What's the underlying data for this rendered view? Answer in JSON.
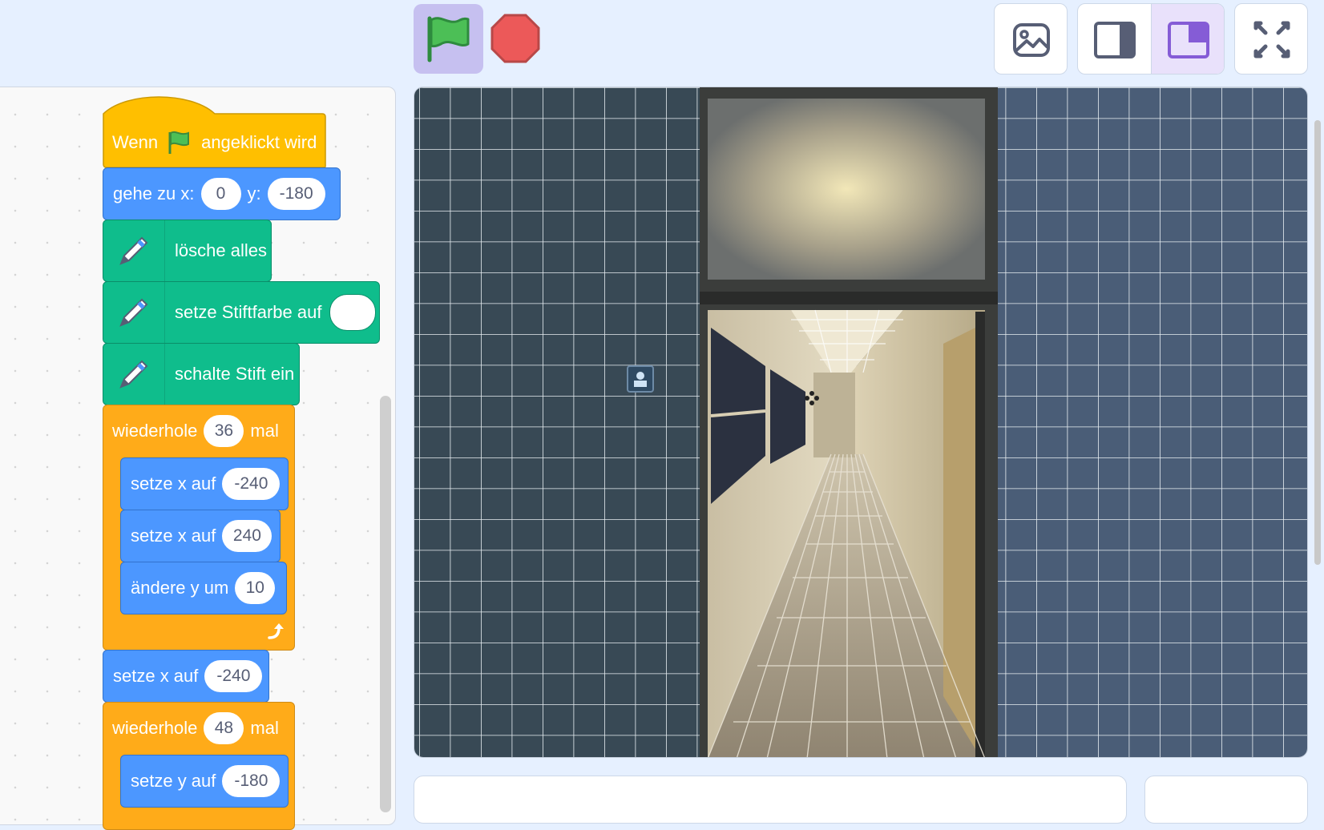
{
  "toolbar": {
    "green_flag": "green-flag-icon",
    "stop": "stop-icon",
    "buttons": [
      "image-icon",
      "small-stage-icon",
      "large-stage-icon",
      "fullscreen-icon"
    ],
    "active_mode": "large-stage",
    "accent": "#855cd6"
  },
  "script": {
    "when_flag": {
      "before": "Wenn",
      "after": "angeklickt wird"
    },
    "goto": {
      "label": "gehe zu x:",
      "x": "0",
      "y_label": "y:",
      "y": "-180"
    },
    "clear": "lösche alles",
    "set_pen_color": "setze Stiftfarbe auf",
    "pen_down": "schalte Stift ein",
    "repeat1": {
      "label": "wiederhole",
      "count": "36",
      "suffix": "mal"
    },
    "set_x1": {
      "label": "setze x auf",
      "value": "-240"
    },
    "set_x2": {
      "label": "setze x auf",
      "value": "240"
    },
    "change_y": {
      "label": "ändere y um",
      "value": "10"
    },
    "set_x3": {
      "label": "setze x auf",
      "value": "-240"
    },
    "repeat2": {
      "label": "wiederhole",
      "count": "48",
      "suffix": "mal"
    },
    "set_y": {
      "label": "setze y auf",
      "value": "-180"
    }
  },
  "colors": {
    "events": "#ffbf00",
    "motion": "#4c97ff",
    "pen": "#0fbd8c",
    "control": "#ffab19"
  }
}
